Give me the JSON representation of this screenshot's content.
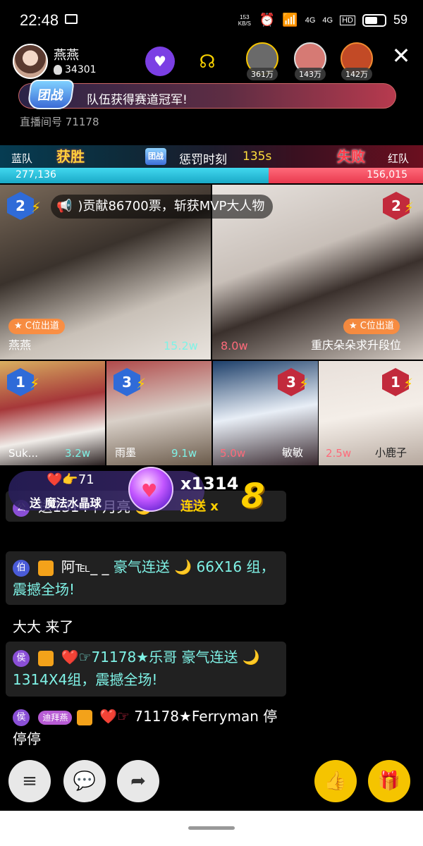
{
  "status_bar": {
    "time": "22:48",
    "net_speed": "153",
    "net_unit": "KB/S",
    "battery": "59",
    "sig1": "4G",
    "sig2": "4G",
    "hd": "HD"
  },
  "header": {
    "host_name": "燕燕",
    "host_fans": "34301",
    "viewers": [
      {
        "amount": "361万",
        "color": "#6a6a6a"
      },
      {
        "amount": "143万",
        "color": "#d67a74"
      },
      {
        "amount": "142万",
        "color": "#c24a26"
      }
    ]
  },
  "banner": {
    "badge": "团战",
    "text": "队伍获得赛道冠军!"
  },
  "room": {
    "label": "直播间号",
    "id": "71178"
  },
  "pk": {
    "blue_label": "蓝队",
    "red_label": "红队",
    "win_text": "获胜",
    "lose_text": "失败",
    "team_badge": "团战",
    "phase": "惩罚时刻",
    "timer": "135s",
    "blue_score": "277,136",
    "red_score": "156,015",
    "blue_fraction": 0.635
  },
  "grid": {
    "mvp_note": ")贡献86700票，斩获MVP大人物",
    "c_badge": "C位出道",
    "large": [
      {
        "name": "燕燕",
        "score": "15.2w",
        "rank": "2",
        "team": "blue",
        "score_color": "#7ff2e6"
      },
      {
        "name": "重庆朵朵求升段位",
        "score": "8.0w",
        "rank": "2",
        "team": "red",
        "score_color": "#ff6a7a"
      }
    ],
    "small": [
      {
        "name": "Suk...",
        "score": "3.2w",
        "rank": "1",
        "team": "blue",
        "score_color": "#7ff2e6"
      },
      {
        "name": "雨墨",
        "score": "9.1w",
        "rank": "3",
        "team": "blue",
        "score_color": "#7ff2e6"
      },
      {
        "name": "敏敏",
        "score": "5.0w",
        "rank": "3",
        "team": "red",
        "score_color": "#ff6a7a"
      },
      {
        "name": "小鹿子",
        "score": "2.5w",
        "rank": "1",
        "team": "red",
        "score_color": "#ff6a7a"
      }
    ]
  },
  "combo": {
    "top": "❤️👉71",
    "sub": "送 魔法水晶球",
    "count": "x1314",
    "lian": "连送",
    "x": "x",
    "n": "8",
    "partial_behind": "送1314个月亮",
    "partial_right": "1178★乐哥"
  },
  "chat": [
    {
      "level": "公",
      "text": "送1314个月亮 🌙"
    },
    {
      "level": "伯",
      "name": "阿℡_ _",
      "action": "豪气连送",
      "gift": "🌙",
      "count": "66X16",
      "tail": "组，震撼全场!"
    },
    {
      "text": "大大 来了"
    },
    {
      "level": "侯",
      "name": "❤️☞71178★乐哥",
      "action": "豪气连送",
      "gift": "🌙",
      "count": "1314X4组，震撼全场!"
    },
    {
      "level": "侯",
      "tag": "迪拜燕",
      "name": "❤️☞",
      "name2": "71178★Ferryman",
      "text": "停停停"
    }
  ]
}
